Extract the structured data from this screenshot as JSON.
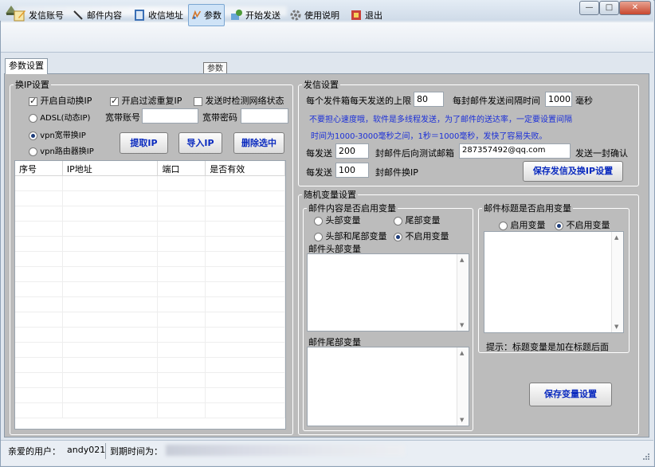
{
  "window": {
    "minimize": "—",
    "maximize": "□",
    "close": "✕"
  },
  "toolbar": [
    {
      "label": "发信账号",
      "icon": "edit-icon"
    },
    {
      "label": "邮件内容",
      "icon": "pen-icon"
    },
    {
      "label": "收信地址",
      "icon": "address-book-icon"
    },
    {
      "label": "参数",
      "icon": "params-icon"
    },
    {
      "label": "开始发送",
      "icon": "send-icon"
    },
    {
      "label": "使用说明",
      "icon": "gear-icon"
    },
    {
      "label": "退出",
      "icon": "exit-icon"
    }
  ],
  "tooltip": "参数",
  "tab": "参数设置",
  "ip": {
    "group_title": "换IP设置",
    "auto_switch": "开启自动换IP",
    "filter_dup": "开启过滤重复IP",
    "check_net": "发送时检测网络状态",
    "adsl": "ADSL(动态IP)",
    "adsl_account": "宽带账号",
    "adsl_password": "宽带密码",
    "vpn_broadband": "vpn宽带换IP",
    "vpn_router": "vpn路由器换IP",
    "btn_fetch": "提取IP",
    "btn_import": "导入IP",
    "btn_delete": "删除选中",
    "columns": [
      "序号",
      "IP地址",
      "端口",
      "是否有效"
    ]
  },
  "send": {
    "group_title": "发信设置",
    "limit_label": "每个发件箱每天发送的上限",
    "limit_value": "80",
    "interval_label": "每封邮件发送间隔时间",
    "interval_value": "1000",
    "interval_unit": "毫秒",
    "hint1": "不要担心速度哦，软件是多线程发送，为了邮件的送达率，一定要设置间隔",
    "hint2": "时间为1000-3000毫秒之间，1秒＝1000毫秒，发快了容易失败。",
    "every_label1": "每发送",
    "every_value1": "200",
    "test_label": "封邮件后向测试邮箱",
    "test_email": "287357492@qq.com",
    "confirm_label": "发送一封确认",
    "every_label2": "每发送",
    "every_value2": "100",
    "switch_ip_label": "封邮件换IP",
    "save_btn": "保存发信及换IP设置"
  },
  "vars": {
    "group_title": "随机变量设置",
    "content_title": "邮件内容是否启用变量",
    "opt_head": "头部变量",
    "opt_tail": "尾部变量",
    "opt_both": "头部和尾部变量",
    "opt_none": "不启用变量",
    "head_label": "邮件头部变量",
    "tail_label": "邮件尾部变量",
    "subject_title": "邮件标题是否启用变量",
    "subj_enable": "启用变量",
    "subj_disable": "不启用变量",
    "tip": "提示：标题变量是加在标题后面",
    "save_btn": "保存变量设置"
  },
  "status": {
    "user_label": "亲爱的用户：",
    "user": "andy021",
    "expire_label": "到期时间为："
  }
}
